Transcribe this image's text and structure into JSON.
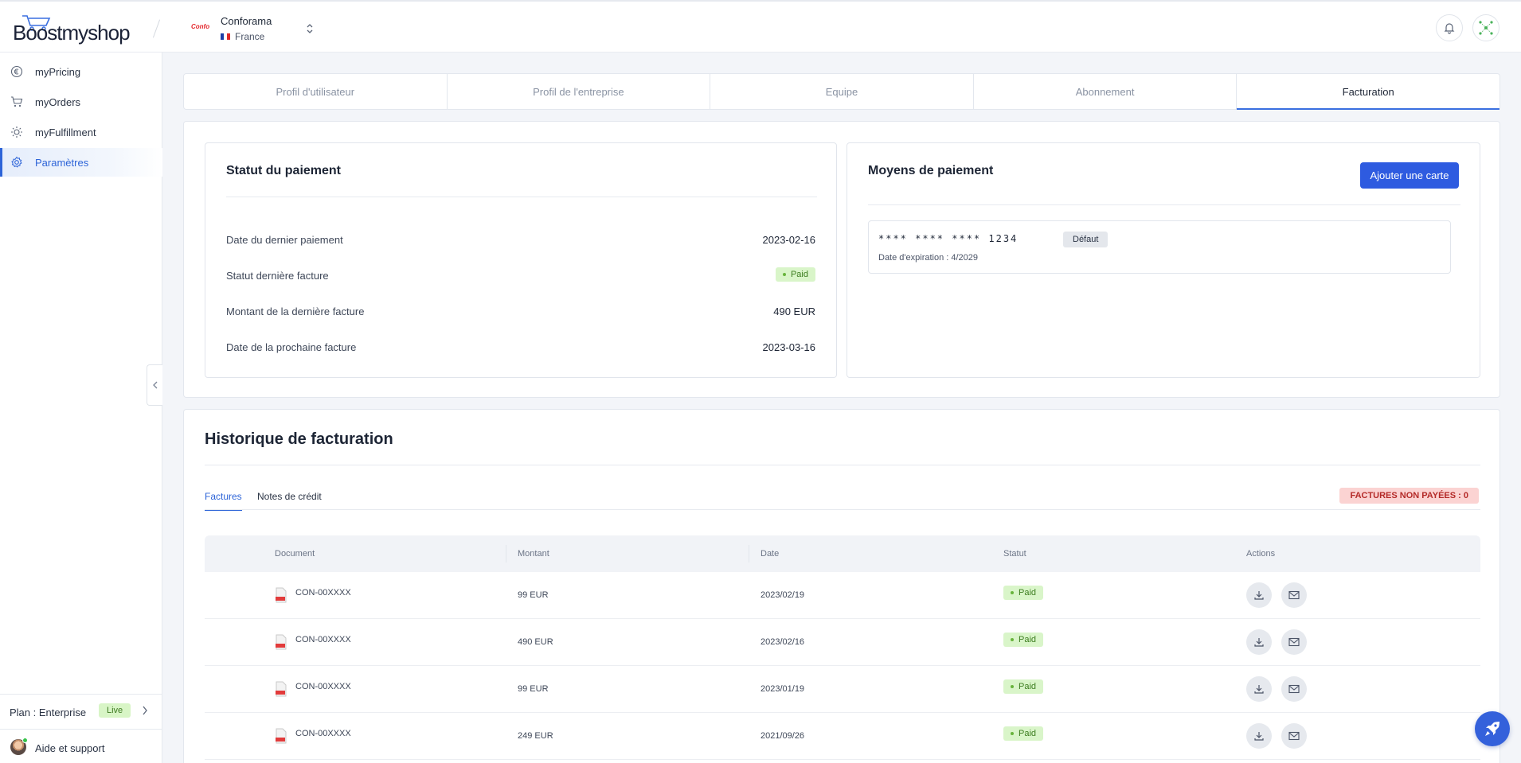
{
  "header": {
    "brand": "Boostmyshop",
    "store_logo_text": "Confo",
    "store_name": "Conforama",
    "store_country": "France"
  },
  "sidebar": {
    "items": [
      {
        "label": "myPricing",
        "icon": "euro-icon"
      },
      {
        "label": "myOrders",
        "icon": "cart-icon"
      },
      {
        "label": "myFulfillment",
        "icon": "sun-icon"
      },
      {
        "label": "Paramètres",
        "icon": "gear-icon",
        "active": true
      }
    ],
    "plan_label": "Plan : Enterprise",
    "plan_badge": "Live",
    "help_label": "Aide et support"
  },
  "tabs": [
    "Profil d'utilisateur",
    "Profil de l'entreprise",
    "Equipe",
    "Abonnement",
    "Facturation"
  ],
  "active_tab": "Facturation",
  "payment_status": {
    "title": "Statut du paiement",
    "rows": [
      {
        "label": "Date du dernier paiement",
        "value": "2023-02-16"
      },
      {
        "label": "Statut dernière facture",
        "value": "Paid"
      },
      {
        "label": "Montant de la dernière facture",
        "value": "490 EUR"
      },
      {
        "label": "Date de la prochaine facture",
        "value": "2023-03-16"
      }
    ]
  },
  "payment_methods": {
    "title": "Moyens de paiement",
    "add_button": "Ajouter une carte",
    "card_number": "**** **** **** 1234",
    "default_label": "Défaut",
    "expiry": "Date d'expiration : 4/2029"
  },
  "history": {
    "title": "Historique de facturation",
    "subtabs": [
      "Factures",
      "Notes de crédit"
    ],
    "unpaid_badge": "FACTURES NON PAYÉES : 0",
    "columns": [
      "Document",
      "Montant",
      "Date",
      "Statut",
      "Actions"
    ],
    "rows": [
      {
        "document": "CON-00XXXX",
        "amount": "99 EUR",
        "date": "2023/02/19",
        "status": "Paid"
      },
      {
        "document": "CON-00XXXX",
        "amount": "490 EUR",
        "date": "2023/02/16",
        "status": "Paid"
      },
      {
        "document": "CON-00XXXX",
        "amount": "99 EUR",
        "date": "2023/01/19",
        "status": "Paid"
      },
      {
        "document": "CON-00XXXX",
        "amount": "249 EUR",
        "date": "2021/09/26",
        "status": "Paid"
      }
    ]
  },
  "colors": {
    "accent": "#2e5be0",
    "paid_bg": "#d9f5c9",
    "unpaid_bg": "#fbd3d2",
    "live_bg": "#d8f5c6"
  }
}
